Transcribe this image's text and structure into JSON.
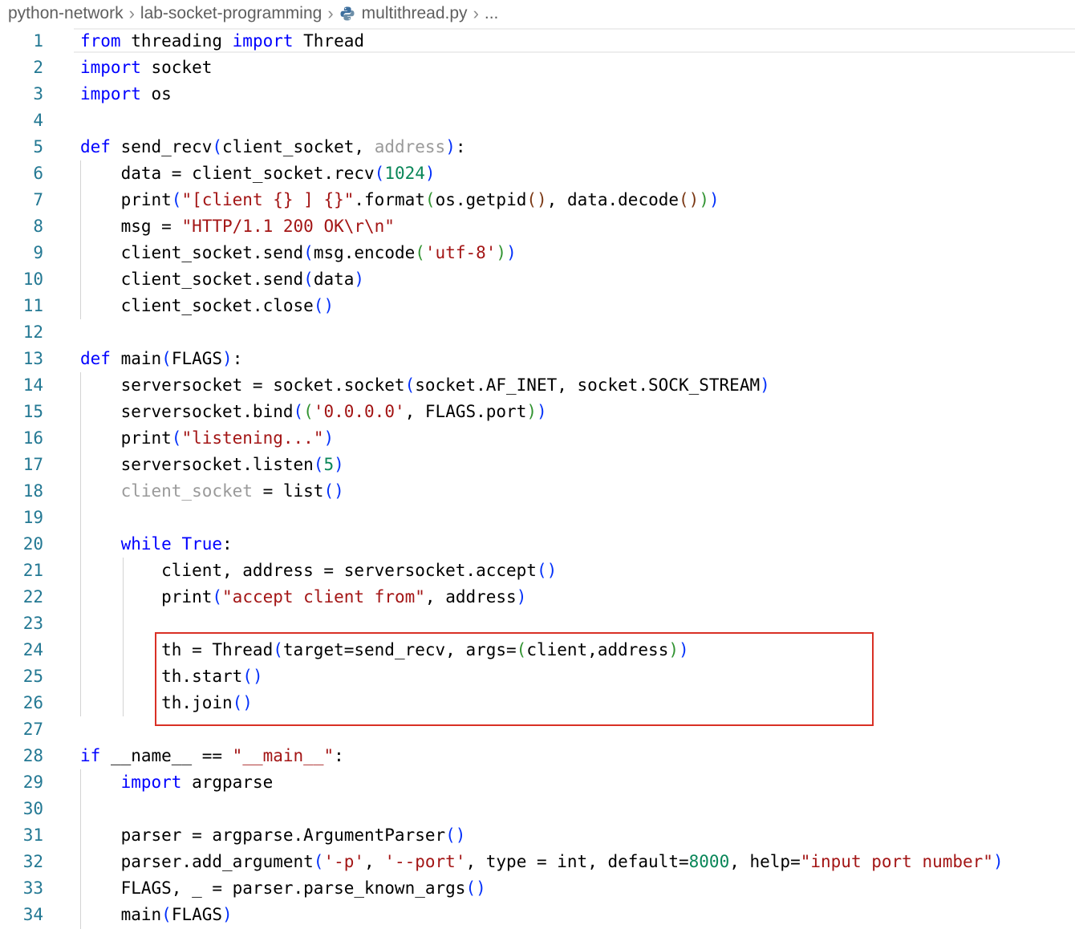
{
  "breadcrumb": {
    "folder1": "python-network",
    "folder2": "lab-socket-programming",
    "file": "multithread.py",
    "more": "..."
  },
  "colors": {
    "keyword": "#0000ff",
    "string": "#a31515",
    "number": "#098658",
    "line_number": "#237893",
    "highlight_box": "#d93025"
  },
  "icons": {
    "separator": "chevron-right-icon",
    "file": "python-file-icon"
  },
  "lines": [
    {
      "n": "1",
      "tokens": [
        [
          "kw",
          "from"
        ],
        [
          "",
          " threading "
        ],
        [
          "kw",
          "import"
        ],
        [
          "",
          " Thread"
        ]
      ]
    },
    {
      "n": "2",
      "tokens": [
        [
          "kw",
          "import"
        ],
        [
          "",
          " socket"
        ]
      ]
    },
    {
      "n": "3",
      "tokens": [
        [
          "kw",
          "import"
        ],
        [
          "",
          " os"
        ]
      ]
    },
    {
      "n": "4",
      "tokens": []
    },
    {
      "n": "5",
      "tokens": [
        [
          "kw",
          "def"
        ],
        [
          "",
          " send_recv"
        ],
        [
          "br1",
          "("
        ],
        [
          "",
          "client_socket, "
        ],
        [
          "dim",
          "address"
        ],
        [
          "br1",
          ")"
        ],
        [
          "",
          ":"
        ]
      ]
    },
    {
      "n": "6",
      "tokens": [
        [
          "",
          "    data = client_socket.recv"
        ],
        [
          "br1",
          "("
        ],
        [
          "num",
          "1024"
        ],
        [
          "br1",
          ")"
        ]
      ]
    },
    {
      "n": "7",
      "tokens": [
        [
          "",
          "    print"
        ],
        [
          "br1",
          "("
        ],
        [
          "str",
          "\"[client {} ] {}\""
        ],
        [
          "",
          ".format"
        ],
        [
          "br2",
          "("
        ],
        [
          "",
          "os.getpid"
        ],
        [
          "br3",
          "()"
        ],
        [
          "",
          ", data.decode"
        ],
        [
          "br3",
          "()"
        ],
        [
          "br2",
          ")"
        ],
        [
          "br1",
          ")"
        ]
      ]
    },
    {
      "n": "8",
      "tokens": [
        [
          "",
          "    msg = "
        ],
        [
          "str",
          "\"HTTP/1.1 200 OK\\r\\n\""
        ]
      ]
    },
    {
      "n": "9",
      "tokens": [
        [
          "",
          "    client_socket.send"
        ],
        [
          "br1",
          "("
        ],
        [
          "",
          "msg.encode"
        ],
        [
          "br2",
          "("
        ],
        [
          "str",
          "'utf-8'"
        ],
        [
          "br2",
          ")"
        ],
        [
          "br1",
          ")"
        ]
      ]
    },
    {
      "n": "10",
      "tokens": [
        [
          "",
          "    client_socket.send"
        ],
        [
          "br1",
          "("
        ],
        [
          "",
          "data"
        ],
        [
          "br1",
          ")"
        ]
      ]
    },
    {
      "n": "11",
      "tokens": [
        [
          "",
          "    client_socket.close"
        ],
        [
          "br1",
          "()"
        ]
      ]
    },
    {
      "n": "12",
      "tokens": []
    },
    {
      "n": "13",
      "tokens": [
        [
          "kw",
          "def"
        ],
        [
          "",
          " main"
        ],
        [
          "br1",
          "("
        ],
        [
          "",
          "FLAGS"
        ],
        [
          "br1",
          ")"
        ],
        [
          "",
          ":"
        ]
      ]
    },
    {
      "n": "14",
      "tokens": [
        [
          "",
          "    serversocket = socket.socket"
        ],
        [
          "br1",
          "("
        ],
        [
          "",
          "socket.AF_INET, socket.SOCK_STREAM"
        ],
        [
          "br1",
          ")"
        ]
      ]
    },
    {
      "n": "15",
      "tokens": [
        [
          "",
          "    serversocket.bind"
        ],
        [
          "br1",
          "("
        ],
        [
          "br2",
          "("
        ],
        [
          "str",
          "'0.0.0.0'"
        ],
        [
          "",
          ", FLAGS.port"
        ],
        [
          "br2",
          ")"
        ],
        [
          "br1",
          ")"
        ]
      ]
    },
    {
      "n": "16",
      "tokens": [
        [
          "",
          "    print"
        ],
        [
          "br1",
          "("
        ],
        [
          "str",
          "\"listening...\""
        ],
        [
          "br1",
          ")"
        ]
      ]
    },
    {
      "n": "17",
      "tokens": [
        [
          "",
          "    serversocket.listen"
        ],
        [
          "br1",
          "("
        ],
        [
          "num",
          "5"
        ],
        [
          "br1",
          ")"
        ]
      ]
    },
    {
      "n": "18",
      "tokens": [
        [
          "",
          "    "
        ],
        [
          "dim",
          "client_socket"
        ],
        [
          "",
          " = list"
        ],
        [
          "br1",
          "()"
        ]
      ]
    },
    {
      "n": "19",
      "tokens": []
    },
    {
      "n": "20",
      "tokens": [
        [
          "",
          "    "
        ],
        [
          "kw",
          "while"
        ],
        [
          "",
          " "
        ],
        [
          "kw",
          "True"
        ],
        [
          "",
          ":"
        ]
      ]
    },
    {
      "n": "21",
      "tokens": [
        [
          "",
          "        client, address = serversocket.accept"
        ],
        [
          "br1",
          "()"
        ]
      ]
    },
    {
      "n": "22",
      "tokens": [
        [
          "",
          "        print"
        ],
        [
          "br1",
          "("
        ],
        [
          "str",
          "\"accept client from\""
        ],
        [
          "",
          ", address"
        ],
        [
          "br1",
          ")"
        ]
      ]
    },
    {
      "n": "23",
      "tokens": []
    },
    {
      "n": "24",
      "tokens": [
        [
          "",
          "        th = Thread"
        ],
        [
          "br1",
          "("
        ],
        [
          "",
          "target=send_recv, args="
        ],
        [
          "br2",
          "("
        ],
        [
          "",
          "client,address"
        ],
        [
          "br2",
          ")"
        ],
        [
          "br1",
          ")"
        ]
      ]
    },
    {
      "n": "25",
      "tokens": [
        [
          "",
          "        th.start"
        ],
        [
          "br1",
          "()"
        ]
      ]
    },
    {
      "n": "26",
      "tokens": [
        [
          "",
          "        th.join"
        ],
        [
          "br1",
          "()"
        ]
      ]
    },
    {
      "n": "27",
      "tokens": []
    },
    {
      "n": "28",
      "tokens": [
        [
          "kw",
          "if"
        ],
        [
          "",
          " __name__ == "
        ],
        [
          "str",
          "\"__main__\""
        ],
        [
          "",
          ":"
        ]
      ]
    },
    {
      "n": "29",
      "tokens": [
        [
          "",
          "    "
        ],
        [
          "kw",
          "import"
        ],
        [
          "",
          " argparse"
        ]
      ]
    },
    {
      "n": "30",
      "tokens": []
    },
    {
      "n": "31",
      "tokens": [
        [
          "",
          "    parser = argparse.ArgumentParser"
        ],
        [
          "br1",
          "()"
        ]
      ]
    },
    {
      "n": "32",
      "tokens": [
        [
          "",
          "    parser.add_argument"
        ],
        [
          "br1",
          "("
        ],
        [
          "str",
          "'-p'"
        ],
        [
          "",
          ", "
        ],
        [
          "str",
          "'--port'"
        ],
        [
          "",
          ", type = int, default="
        ],
        [
          "num",
          "8000"
        ],
        [
          "",
          ", help="
        ],
        [
          "str",
          "\"input port number\""
        ],
        [
          "br1",
          ")"
        ]
      ]
    },
    {
      "n": "33",
      "tokens": [
        [
          "",
          "    FLAGS, _ = parser.parse_known_args"
        ],
        [
          "br1",
          "()"
        ]
      ]
    },
    {
      "n": "34",
      "tokens": [
        [
          "",
          "    main"
        ],
        [
          "br1",
          "("
        ],
        [
          "",
          "FLAGS"
        ],
        [
          "br1",
          ")"
        ]
      ]
    }
  ]
}
